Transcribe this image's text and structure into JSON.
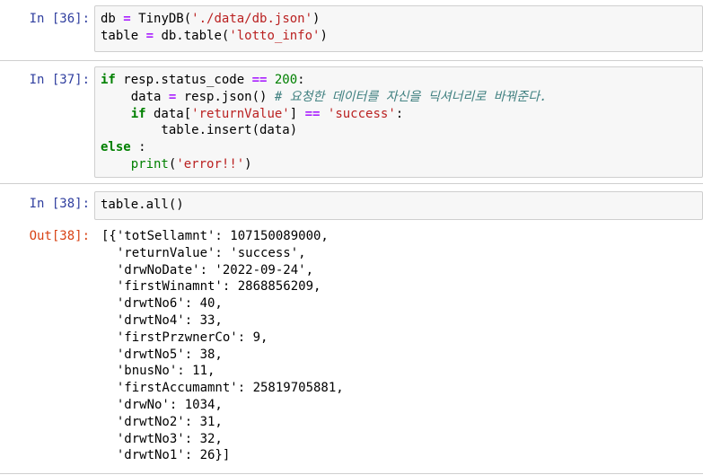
{
  "cells": [
    {
      "prompt": "In [36]:",
      "lines": [
        [
          {
            "t": "db ",
            "c": ""
          },
          {
            "t": "=",
            "c": "op"
          },
          {
            "t": " TinyDB(",
            "c": ""
          },
          {
            "t": "'./data/db.json'",
            "c": "str"
          },
          {
            "t": ")",
            "c": ""
          }
        ],
        [
          {
            "t": "table ",
            "c": ""
          },
          {
            "t": "=",
            "c": "op"
          },
          {
            "t": " db.table(",
            "c": ""
          },
          {
            "t": "'lotto_info'",
            "c": "str"
          },
          {
            "t": ")",
            "c": ""
          }
        ]
      ]
    },
    {
      "prompt": "In [37]:",
      "lines": [
        [
          {
            "t": "if",
            "c": "kw"
          },
          {
            "t": " resp.status_code ",
            "c": ""
          },
          {
            "t": "==",
            "c": "op"
          },
          {
            "t": " ",
            "c": ""
          },
          {
            "t": "200",
            "c": "num"
          },
          {
            "t": ":",
            "c": ""
          }
        ],
        [
          {
            "t": "    data ",
            "c": ""
          },
          {
            "t": "=",
            "c": "op"
          },
          {
            "t": " resp.json() ",
            "c": ""
          },
          {
            "t": "# 요청한 데이터를 자신을 딕셔너리로 바꿔준다.",
            "c": "cm"
          }
        ],
        [
          {
            "t": "    ",
            "c": ""
          },
          {
            "t": "if",
            "c": "kw"
          },
          {
            "t": " data[",
            "c": ""
          },
          {
            "t": "'returnValue'",
            "c": "str"
          },
          {
            "t": "] ",
            "c": ""
          },
          {
            "t": "==",
            "c": "op"
          },
          {
            "t": " ",
            "c": ""
          },
          {
            "t": "'success'",
            "c": "str"
          },
          {
            "t": ":",
            "c": ""
          }
        ],
        [
          {
            "t": "        table.insert(data)",
            "c": ""
          }
        ],
        [
          {
            "t": "else",
            "c": "kw"
          },
          {
            "t": " :",
            "c": ""
          }
        ],
        [
          {
            "t": "    ",
            "c": ""
          },
          {
            "t": "print",
            "c": "num"
          },
          {
            "t": "(",
            "c": ""
          },
          {
            "t": "'error!!'",
            "c": "str"
          },
          {
            "t": ")",
            "c": ""
          }
        ]
      ]
    },
    {
      "prompt": "In [38]:",
      "lines": [
        [
          {
            "t": "table.all()",
            "c": ""
          }
        ]
      ]
    }
  ],
  "output": {
    "prompt": "Out[38]:",
    "lines": [
      "[{'totSellamnt': 107150089000,",
      "  'returnValue': 'success',",
      "  'drwNoDate': '2022-09-24',",
      "  'firstWinamnt': 2868856209,",
      "  'drwtNo6': 40,",
      "  'drwtNo4': 33,",
      "  'firstPrzwnerCo': 9,",
      "  'drwtNo5': 38,",
      "  'bnusNo': 11,",
      "  'firstAccumamnt': 25819705881,",
      "  'drwNo': 1034,",
      "  'drwtNo2': 31,",
      "  'drwtNo3': 32,",
      "  'drwtNo1': 26}]"
    ]
  }
}
